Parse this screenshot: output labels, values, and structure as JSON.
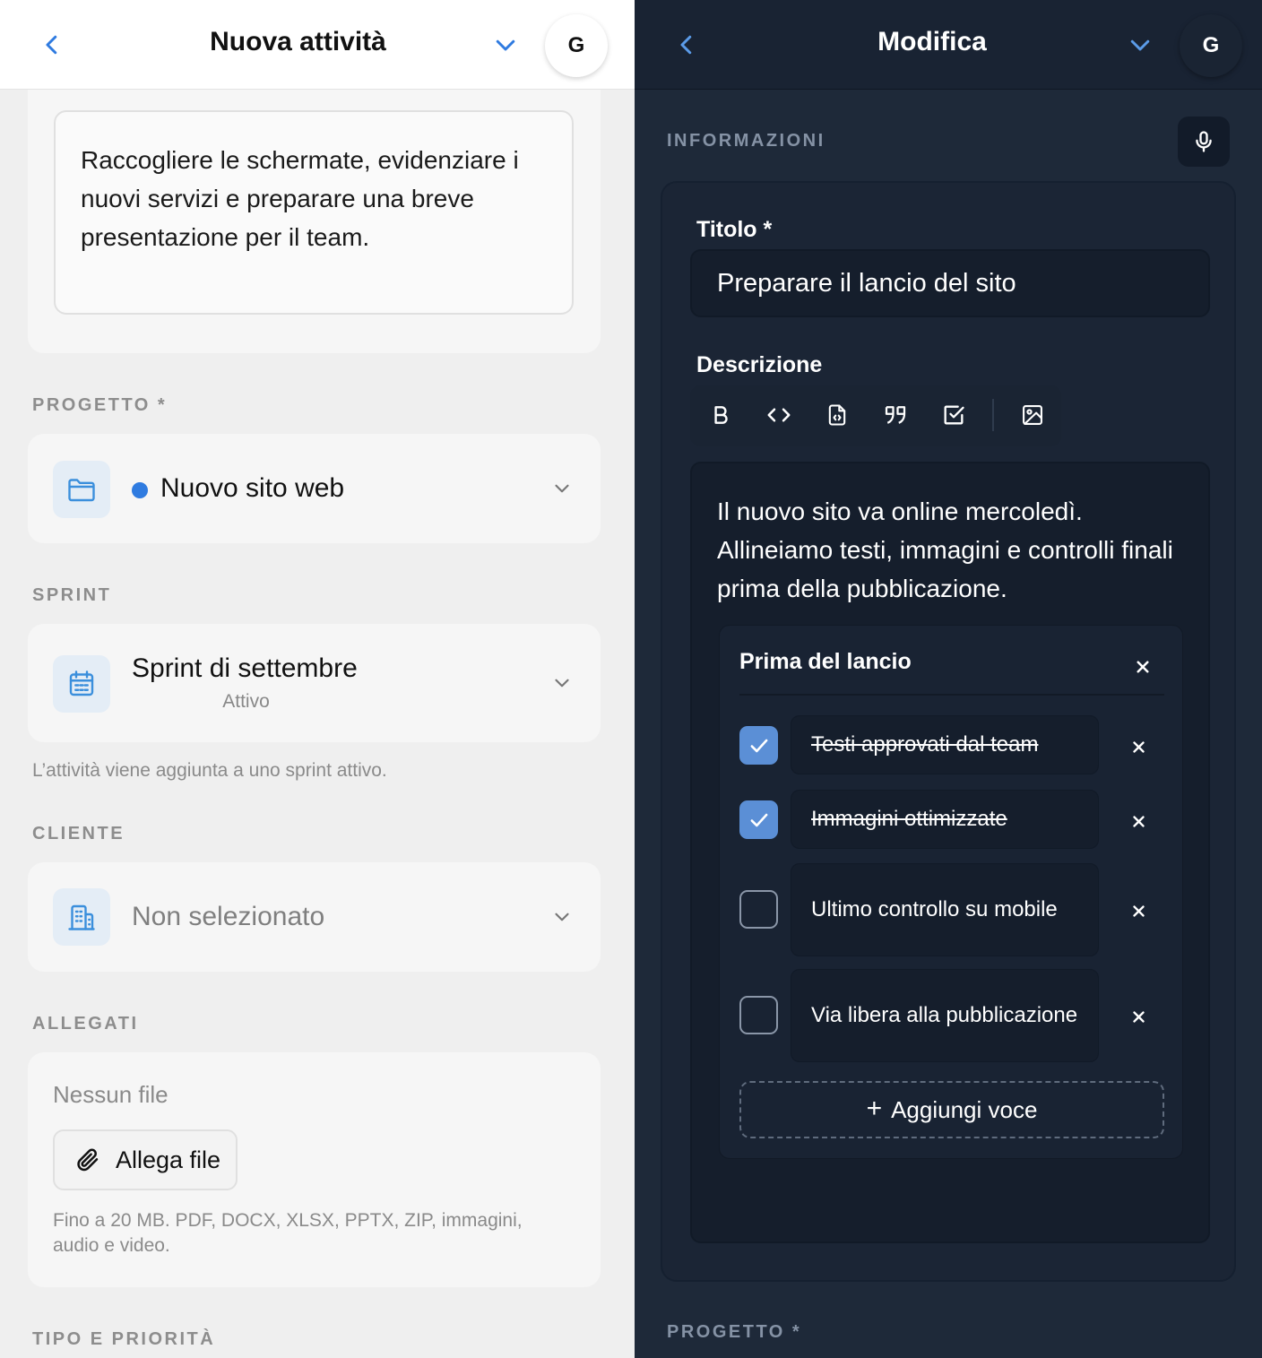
{
  "left": {
    "header": {
      "title": "Nuova attività",
      "avatar_initial": "G"
    },
    "description_text": "Raccogliere le schermate, evidenziare i nuovi servizi e preparare una breve presentazione per il team.",
    "project": {
      "label": "PROGETTO *",
      "value": "Nuovo sito web",
      "dot_color": "#2f7be0"
    },
    "sprint": {
      "label": "SPRINT",
      "name": "Sprint di settembre",
      "status": "Attivo",
      "hint": "L’attività viene aggiunta a uno sprint attivo."
    },
    "client": {
      "label": "CLIENTE",
      "value": "Non selezionato"
    },
    "attachments": {
      "label": "ALLEGATI",
      "empty_text": "Nessun file",
      "button_label": "Allega file",
      "hint": "Fino a 20 MB. PDF, DOCX, XLSX, PPTX, ZIP, immagini, audio e video."
    },
    "type_priority_label": "TIPO E PRIORITÀ"
  },
  "right": {
    "header": {
      "title": "Modifica",
      "avatar_initial": "G"
    },
    "info_label": "INFORMAZIONI",
    "title_field": {
      "label": "Titolo *",
      "value": "Preparare il lancio del sito"
    },
    "description_field": {
      "label": "Descrizione",
      "text": "Il nuovo sito va online mercoledì. Allineiamo testi, immagini e controlli finali prima della pubblicazione."
    },
    "checklist": {
      "title": "Prima del lancio",
      "items": [
        {
          "text": "Testi approvati dal team",
          "checked": true
        },
        {
          "text": "Immagini ottimizzate",
          "checked": true
        },
        {
          "text": "Ultimo controllo su mobile",
          "checked": false
        },
        {
          "text": "Via libera alla pubblicazione",
          "checked": false
        }
      ],
      "add_label": "Aggiungi voce"
    },
    "project_label": "PROGETTO *"
  },
  "colors": {
    "accent_blue": "#2f7be0",
    "checkbox_checked": "#5b8fd6",
    "dark_bg": "#1e2939",
    "light_bg": "#efefef"
  },
  "icons": [
    "chevron-left-icon",
    "chevron-down-icon",
    "folder-icon",
    "calendar-icon",
    "building-icon",
    "paperclip-icon",
    "microphone-icon",
    "bold-icon",
    "code-icon",
    "code-file-icon",
    "quote-icon",
    "checkbox-icon",
    "image-icon",
    "close-icon",
    "check-icon",
    "plus-icon"
  ]
}
